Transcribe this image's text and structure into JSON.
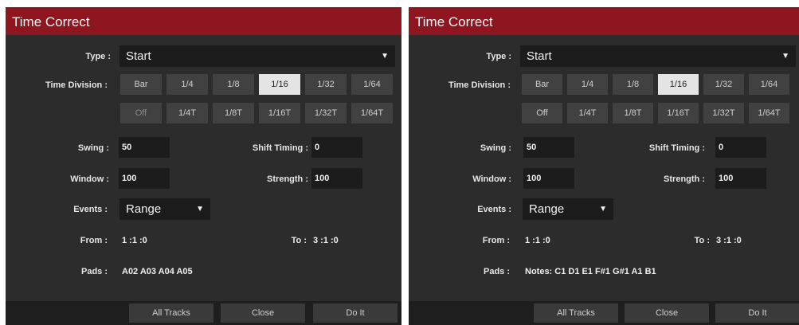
{
  "left": {
    "title": "Time Correct",
    "type_label": "Type :",
    "type_value": "Start",
    "time_division_label": "Time Division :",
    "divisions_row1": [
      "Bar",
      "1/4",
      "1/8",
      "1/16",
      "1/32",
      "1/64"
    ],
    "divisions_row2": [
      "Off",
      "1/4T",
      "1/8T",
      "1/16T",
      "1/32T",
      "1/64T"
    ],
    "selected_division": "1/16",
    "swing_label": "Swing :",
    "swing_value": "50",
    "shift_label": "Shift Timing :",
    "shift_value": "0",
    "window_label": "Window :",
    "window_value": "100",
    "strength_label": "Strength :",
    "strength_value": "100",
    "events_label": "Events :",
    "events_value": "Range",
    "from_label": "From :",
    "from_value": "1 :1 :0",
    "to_label": "To :",
    "to_value": "3 :1 :0",
    "pads_label": "Pads :",
    "pads_value": "A02 A03 A04 A05",
    "all_tracks": "All Tracks",
    "close": "Close",
    "do_it": "Do It"
  },
  "right": {
    "title": "Time Correct",
    "type_label": "Type :",
    "type_value": "Start",
    "time_division_label": "Time Division :",
    "divisions_row1": [
      "Bar",
      "1/4",
      "1/8",
      "1/16",
      "1/32",
      "1/64"
    ],
    "divisions_row2": [
      "Off",
      "1/4T",
      "1/8T",
      "1/16T",
      "1/32T",
      "1/64T"
    ],
    "selected_division": "1/16",
    "swing_label": "Swing :",
    "swing_value": "50",
    "shift_label": "Shift Timing :",
    "shift_value": "0",
    "window_label": "Window :",
    "window_value": "100",
    "strength_label": "Strength :",
    "strength_value": "100",
    "events_label": "Events :",
    "events_value": "Range",
    "from_label": "From :",
    "from_value": "1 :1 :0",
    "to_label": "To :",
    "to_value": "3 :1 :0",
    "pads_label": "Pads :",
    "pads_value": "Notes: C1 D1 E1 F#1 G#1 A1 B1",
    "all_tracks": "All Tracks",
    "close": "Close",
    "do_it": "Do It"
  },
  "icons": {
    "dropdown": "caret-down-icon"
  },
  "colors": {
    "title_bar": "#8e1621",
    "panel": "#2c2c2c",
    "selected": "#e4e4e4"
  }
}
